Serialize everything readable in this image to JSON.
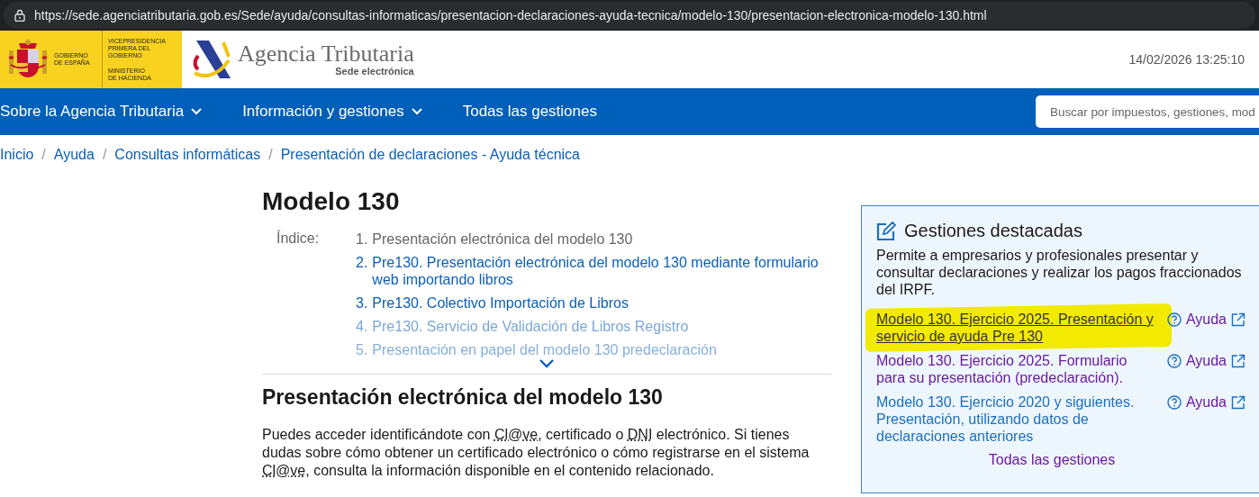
{
  "browser": {
    "url": "https://sede.agenciatributaria.gob.es/Sede/ayuda/consultas-informaticas/presentacion-declaraciones-ayuda-tecnica/modelo-130/presentacion-electronica-modelo-130.html"
  },
  "header": {
    "gov_lines": [
      "GOBIERNO",
      "DE ESPAÑA"
    ],
    "ministry_lines": [
      [
        "VICEPRESIDENCIA",
        "PRIMERA DEL GOBIERNO"
      ],
      [
        "MINISTERIO",
        "DE HACIENDA"
      ]
    ],
    "logo_title": "Agencia Tributaria",
    "logo_subtitle": "Sede electrónica",
    "datetime": "14/02/2026 13:25:10"
  },
  "nav": {
    "items": [
      {
        "label": "Sobre la Agencia Tributaria",
        "has_menu": true
      },
      {
        "label": "Información y gestiones",
        "has_menu": true
      },
      {
        "label": "Todas las gestiones",
        "has_menu": false
      }
    ],
    "search": {
      "placeholder": "Buscar por impuestos, gestiones, mod"
    }
  },
  "breadcrumb": [
    {
      "label": "Inicio"
    },
    {
      "separator": "/",
      "label": "Ayuda"
    },
    {
      "separator": "/",
      "label": "Consultas informáticas"
    },
    {
      "separator": "/",
      "label": "Presentación de declaraciones - Ayuda técnica"
    }
  ],
  "title": "Modelo 130",
  "index": {
    "label": "Índice:",
    "items": [
      {
        "number": "1.",
        "text": "Presentación electrónica del modelo 130",
        "current": true
      },
      {
        "number": "2.",
        "text": "Pre130. Presentación electrónica del modelo 130 mediante formulario web importando libros",
        "current": false
      },
      {
        "number": "3.",
        "text": "Pre130. Colectivo Importación de Libros",
        "current": false
      },
      {
        "number": "4.",
        "text": "Pre130. Servicio de Validación de Libros Registro",
        "current": false
      },
      {
        "number": "5.",
        "text": "Presentación en papel del modelo 130 predeclaración",
        "current": false
      }
    ]
  },
  "section": {
    "heading": "Presentación electrónica del modelo 130",
    "paragraph": [
      {
        "text": "Puedes acceder identificándote con ",
        "abbr": false
      },
      {
        "text": "Cl@ve",
        "abbr": true
      },
      {
        "text": ", certificado o ",
        "abbr": false
      },
      {
        "text": "DNI",
        "abbr": true
      },
      {
        "text": " electrónico. Si tienes dudas sobre cómo obtener un certificado electrónico o cómo registrarse en el sistema ",
        "abbr": false
      },
      {
        "text": "Cl@ve",
        "abbr": true
      },
      {
        "text": ", consulta la información disponible en el contenido relacionado.",
        "abbr": false
      }
    ]
  },
  "sidebar": {
    "title": "Gestiones destacadas",
    "description": "Permite a empresarios y profesionales presentar y consultar declaraciones y realizar los pagos fraccionados del IRPF.",
    "links": [
      {
        "text": "Modelo 130. Ejercicio 2025. Presentación y servicio de ayuda Pre 130",
        "help": "Ayuda",
        "highlighted": true,
        "hovered": true,
        "visited": false
      },
      {
        "text": "Modelo 130. Ejercicio 2025. Formulario para su presentación (predeclaración).",
        "help": "Ayuda",
        "highlighted": false,
        "hovered": false,
        "visited": true
      },
      {
        "text": "Modelo 130. Ejercicio 2020 y siguientes. Presentación, utilizando datos de declaraciones anteriores",
        "help": "Ayuda",
        "highlighted": false,
        "hovered": false,
        "visited": false
      }
    ],
    "all_link": "Todas las gestiones"
  }
}
